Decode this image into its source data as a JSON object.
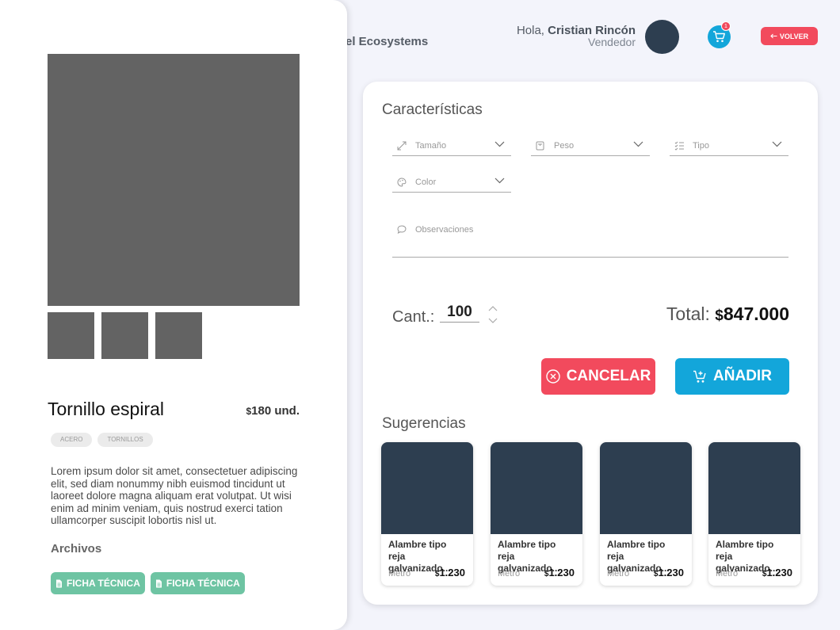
{
  "header": {
    "brand": "el Ecosystems",
    "greeting": "Hola,",
    "user_name": "Cristian Rincón",
    "user_role": "Vendedor",
    "cart_count": "1",
    "back_label": "VOLVER"
  },
  "product": {
    "name": "Tornillo espiral",
    "price_currency": "$",
    "price": "180 und.",
    "tags": [
      "ACERO",
      "TORNILLOS"
    ],
    "description": "Lorem ipsum dolor sit amet, consectetuer adipiscing elit, sed diam nonummy nibh euismod tincidunt ut laoreet dolore magna aliquam erat volutpat. Ut wisi enim ad minim veniam, quis nostrud exerci tation ullamcorper suscipit lobortis nisl ut.",
    "files_title": "Archivos",
    "files": [
      "FICHA TÉCNICA",
      "FICHA TÉCNICA"
    ]
  },
  "characteristics": {
    "title": "Características",
    "fields": {
      "size": "Tamaño",
      "weight": "Peso",
      "type": "Tipo",
      "color": "Color"
    },
    "observations_placeholder": "Observaciones",
    "quantity_label": "Cant.:",
    "quantity": "100",
    "total_label": "Total:",
    "total_currency": "$",
    "total_value": "847.000",
    "cancel_label": "CANCELAR",
    "add_label": "AÑADIR"
  },
  "suggestions": {
    "title": "Sugerencias",
    "items": [
      {
        "name_line1": "Alambre tipo reja",
        "name_line2": "galvanizado...",
        "unit": "Metro",
        "currency": "$",
        "price": "1.230"
      },
      {
        "name_line1": "Alambre tipo reja",
        "name_line2": "galvanizado...",
        "unit": "Metro",
        "currency": "$",
        "price": "1.230"
      },
      {
        "name_line1": "Alambre tipo reja",
        "name_line2": "galvanizado...",
        "unit": "Metro",
        "currency": "$",
        "price": "1.230"
      },
      {
        "name_line1": "Alambre tipo reja",
        "name_line2": "galvanizado...",
        "unit": "Metro",
        "currency": "$",
        "price": "1.230"
      }
    ]
  },
  "colors": {
    "danger": "#f24a5d",
    "primary": "#13a6da",
    "success": "#6ec4a3",
    "dark": "#2d3e50",
    "placeholder_image": "#636363"
  },
  "icons": {
    "cart": "cart-icon",
    "back": "arrow-left-icon",
    "size": "expand-icon",
    "weight": "scale-icon",
    "type": "checklist-icon",
    "color": "palette-icon",
    "observations": "comment-icon",
    "cancel": "close-circle-icon",
    "add": "cart-plus-icon",
    "file": "document-icon"
  }
}
